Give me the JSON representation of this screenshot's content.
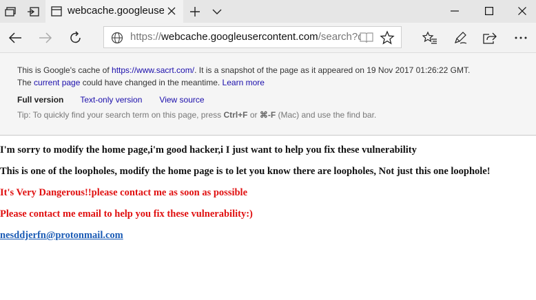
{
  "browser": {
    "tab_title": "webcache.googleusercc",
    "address_host": "webcache.googleusercontent.com",
    "address_prefix": "https://",
    "address_path": "/search?q=cacl"
  },
  "banner": {
    "cache_prefix": "This is Google's cache of ",
    "cache_link": "https://www.sacrt.com/",
    "cache_suffix": ". It is a snapshot of the page as it appeared on 19 Nov 2017 01:26:22 GMT.",
    "line2_prefix": "The ",
    "current_page_link": "current page",
    "line2_middle": " could have changed in the meantime. ",
    "learn_more_link": "Learn more",
    "full_version": "Full version",
    "text_only_link": "Text-only version",
    "view_source_link": "View source",
    "tip_prefix": "Tip: To quickly find your search term on this page, press ",
    "tip_key1": "Ctrl+F",
    "tip_or": " or ",
    "tip_key2": "⌘-F",
    "tip_suffix": " (Mac) and use the find bar."
  },
  "page": {
    "line1": "I'm sorry to modify the home page,i'm good hacker,i I just want to help you fix these vulnerability",
    "line2": "This is one of the loopholes, modify the home page is to let you know there are loopholes, Not just this one loophole!",
    "line3": "It's Very Dangerous!!please contact me as soon as possible",
    "line4": "Please contact me email to help you fix these vulnerability:)",
    "email": "nesddjerfn@protonmail.com"
  },
  "colors": {
    "warning_red": "#e01010",
    "link_blue": "#1a0dab",
    "email_blue": "#1a5bb5"
  }
}
